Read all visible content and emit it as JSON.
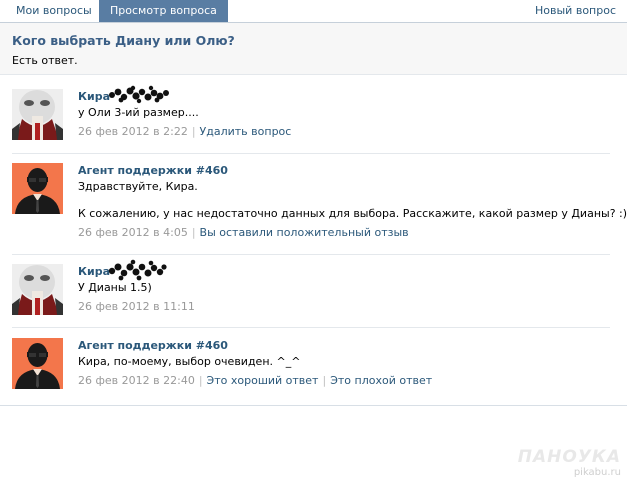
{
  "tabs": {
    "my_questions": "Мои вопросы",
    "view_question": "Просмотр вопроса",
    "new_question": "Новый вопрос"
  },
  "question": {
    "title": "Кого выбрать Диану или Олю?",
    "status": "Есть ответ."
  },
  "messages": [
    {
      "author": "Кира",
      "lines": [
        "у Оли 3-ий размер...."
      ],
      "date": "26 фев 2012 в 2:22",
      "actions": [
        "Удалить вопрос"
      ]
    },
    {
      "author": "Агент поддержки #460",
      "lines": [
        "Здравствуйте, Кира.",
        "К сожалению, у нас недостаточно данных для выбора. Расскажите, какой размер у Дианы? :)"
      ],
      "date": "26 фев 2012 в 4:05",
      "actions": [
        "Вы оставили положительный отзыв"
      ]
    },
    {
      "author": "Кира",
      "lines": [
        "У Дианы 1.5)"
      ],
      "date": "26 фев 2012 в 11:11",
      "actions": []
    },
    {
      "author": "Агент поддержки #460",
      "lines": [
        "Кира, по-моему, выбор очевиден. ^_^"
      ],
      "date": "26 фев 2012 в 22:40",
      "actions": [
        "Это хороший ответ",
        "Это плохой ответ"
      ]
    }
  ],
  "watermark": {
    "brand": "ПАНОУКА",
    "site": "pikabu.ru"
  },
  "colors": {
    "link": "#2b587a",
    "active_tab": "#597da3",
    "title": "#3b5f86",
    "agent_avatar_bg": "#f3764b"
  },
  "icons": {
    "user_avatar": "user-avatar-face",
    "agent_avatar": "agent-silhouette-icon"
  }
}
